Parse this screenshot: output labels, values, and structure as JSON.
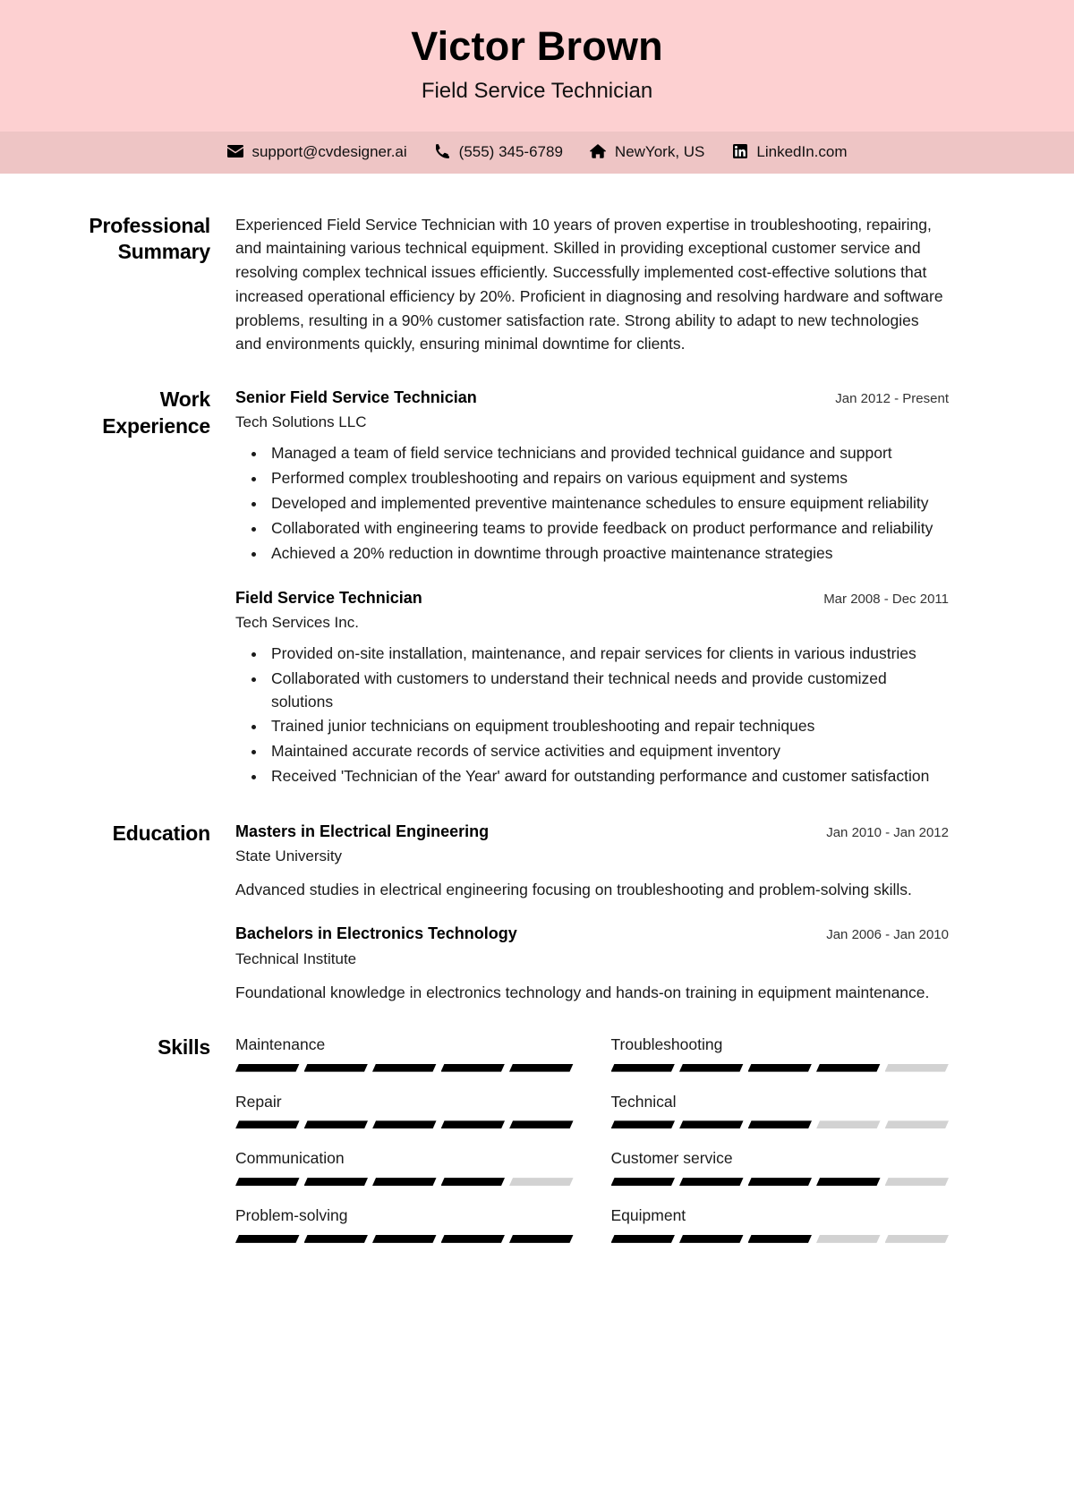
{
  "header": {
    "name": "Victor Brown",
    "title": "Field Service Technician",
    "band_color": "#fdd0d1",
    "contact_band_color": "#eec5c5",
    "contacts": [
      {
        "icon": "email-icon",
        "text": "support@cvdesigner.ai"
      },
      {
        "icon": "phone-icon",
        "text": "(555) 345-6789"
      },
      {
        "icon": "home-icon",
        "text": "NewYork, US"
      },
      {
        "icon": "linkedin-icon",
        "text": "LinkedIn.com"
      }
    ]
  },
  "sections": {
    "summary": {
      "label": "Professional Summary",
      "text": "Experienced Field Service Technician with 10 years of proven expertise in troubleshooting, repairing, and maintaining various technical equipment. Skilled in providing exceptional customer service and resolving complex technical issues efficiently. Successfully implemented cost-effective solutions that increased operational efficiency by 20%. Proficient in diagnosing and resolving hardware and software problems, resulting in a 90% customer satisfaction rate. Strong ability to adapt to new technologies and environments quickly, ensuring minimal downtime for clients."
    },
    "experience": {
      "label": "Work Experience",
      "entries": [
        {
          "title": "Senior Field Service Technician",
          "org": "Tech Solutions LLC",
          "date": "Jan 2012 - Present",
          "bullets": [
            "Managed a team of field service technicians and provided technical guidance and support",
            "Performed complex troubleshooting and repairs on various equipment and systems",
            "Developed and implemented preventive maintenance schedules to ensure equipment reliability",
            "Collaborated with engineering teams to provide feedback on product performance and reliability",
            "Achieved a 20% reduction in downtime through proactive maintenance strategies"
          ]
        },
        {
          "title": "Field Service Technician",
          "org": "Tech Services Inc.",
          "date": "Mar 2008 - Dec 2011",
          "bullets": [
            "Provided on-site installation, maintenance, and repair services for clients in various industries",
            "Collaborated with customers to understand their technical needs and provide customized solutions",
            "Trained junior technicians on equipment troubleshooting and repair techniques",
            "Maintained accurate records of service activities and equipment inventory",
            "Received 'Technician of the Year' award for outstanding performance and customer satisfaction"
          ]
        }
      ]
    },
    "education": {
      "label": "Education",
      "entries": [
        {
          "title": "Masters in Electrical Engineering",
          "org": "State University",
          "date": "Jan 2010 - Jan 2012",
          "desc": "Advanced studies in electrical engineering focusing on troubleshooting and problem-solving skills."
        },
        {
          "title": "Bachelors in Electronics Technology",
          "org": "Technical Institute",
          "date": "Jan 2006 - Jan 2010",
          "desc": "Foundational knowledge in electronics technology and hands-on training in equipment maintenance."
        }
      ]
    },
    "skills": {
      "label": "Skills",
      "max_level": 5,
      "items": [
        {
          "name": "Maintenance",
          "level": 5
        },
        {
          "name": "Troubleshooting",
          "level": 4
        },
        {
          "name": "Repair",
          "level": 5
        },
        {
          "name": "Technical",
          "level": 3
        },
        {
          "name": "Communication",
          "level": 4
        },
        {
          "name": "Customer service",
          "level": 4
        },
        {
          "name": "Problem-solving",
          "level": 5
        },
        {
          "name": "Equipment",
          "level": 3
        }
      ]
    }
  }
}
